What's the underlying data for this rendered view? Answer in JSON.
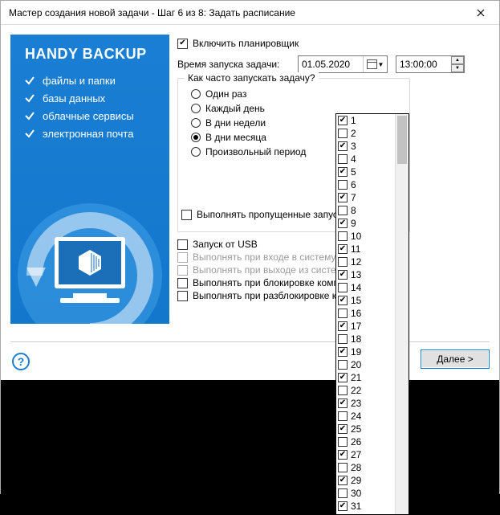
{
  "window": {
    "title": "Мастер создания новой задачи - Шаг 6 из 8: Задать расписание"
  },
  "sidebar": {
    "brand": "HANDY BACKUP",
    "items": [
      {
        "label": "файлы и папки"
      },
      {
        "label": "базы данных"
      },
      {
        "label": "облачные сервисы"
      },
      {
        "label": "электронная почта"
      }
    ]
  },
  "main": {
    "enable_scheduler": {
      "label": "Включить планировщик",
      "checked": true
    },
    "start_time_label": "Время запуска задачи:",
    "date_value": "01.05.2020",
    "time_value": "13:00:00",
    "freq_group_legend": "Как часто запускать задачу?",
    "freq_options": [
      {
        "label": "Один раз",
        "checked": false
      },
      {
        "label": "Каждый день",
        "checked": false
      },
      {
        "label": "В дни недели",
        "checked": false
      },
      {
        "label": "В дни месяца",
        "checked": true
      },
      {
        "label": "Произвольный период",
        "checked": false
      }
    ],
    "run_missed": {
      "label": "Выполнять пропущенные запуски",
      "checked": false
    },
    "usb": {
      "label": "Запуск от USB",
      "checked": false
    },
    "login": {
      "label": "Выполнять при входе в систему",
      "checked": false,
      "disabled": true
    },
    "logout": {
      "label": "Выполнять при выходе из системы",
      "checked": false,
      "disabled": true
    },
    "lock": {
      "label": "Выполнять при блокировке компьют",
      "checked": false
    },
    "unlock": {
      "label": "Выполнять при разблокировке комп",
      "checked": false
    }
  },
  "days": [
    {
      "n": "1",
      "c": true
    },
    {
      "n": "2",
      "c": false
    },
    {
      "n": "3",
      "c": true
    },
    {
      "n": "4",
      "c": false
    },
    {
      "n": "5",
      "c": true
    },
    {
      "n": "6",
      "c": false
    },
    {
      "n": "7",
      "c": true
    },
    {
      "n": "8",
      "c": false
    },
    {
      "n": "9",
      "c": true
    },
    {
      "n": "10",
      "c": false
    },
    {
      "n": "11",
      "c": true
    },
    {
      "n": "12",
      "c": false
    },
    {
      "n": "13",
      "c": true
    },
    {
      "n": "14",
      "c": false
    },
    {
      "n": "15",
      "c": true
    },
    {
      "n": "16",
      "c": false
    },
    {
      "n": "17",
      "c": true
    },
    {
      "n": "18",
      "c": false
    },
    {
      "n": "19",
      "c": true
    },
    {
      "n": "20",
      "c": false
    },
    {
      "n": "21",
      "c": true
    },
    {
      "n": "22",
      "c": false
    },
    {
      "n": "23",
      "c": true
    },
    {
      "n": "24",
      "c": false
    },
    {
      "n": "25",
      "c": true
    },
    {
      "n": "26",
      "c": false
    },
    {
      "n": "27",
      "c": true
    },
    {
      "n": "28",
      "c": false
    },
    {
      "n": "29",
      "c": true
    },
    {
      "n": "30",
      "c": false
    },
    {
      "n": "31",
      "c": true
    }
  ],
  "footer": {
    "next": "Далее >",
    "help_glyph": "?"
  }
}
